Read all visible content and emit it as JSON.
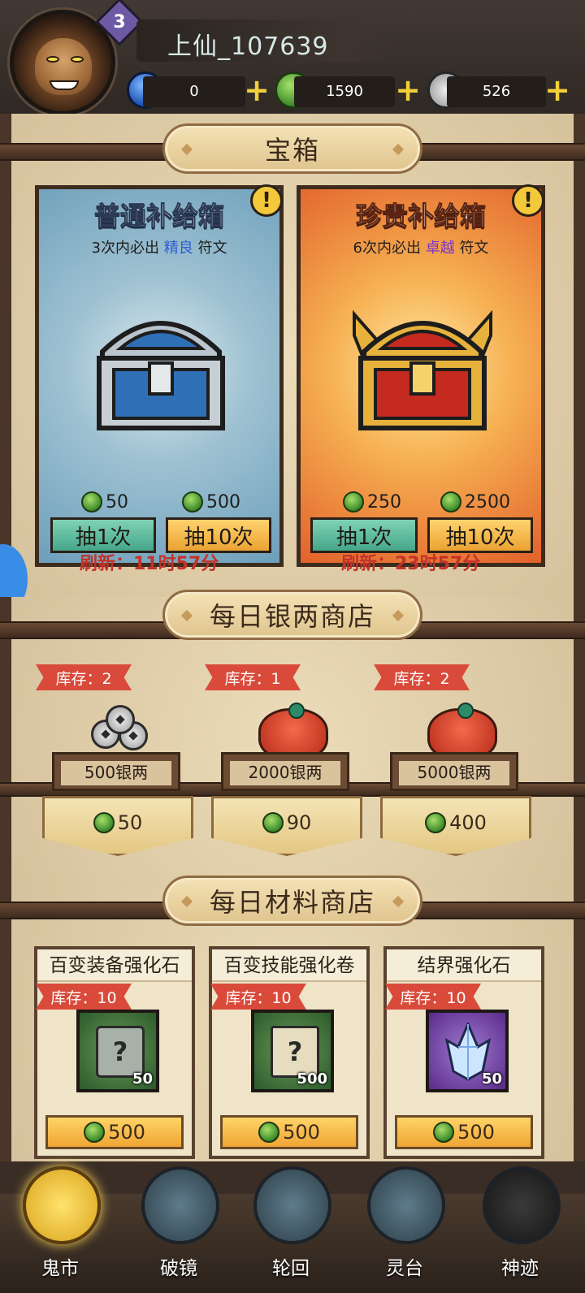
{
  "player": {
    "level": "3",
    "name": "上仙_107639"
  },
  "currencies": [
    {
      "icon": "blue-gem-icon",
      "value": "0"
    },
    {
      "icon": "jade-icon",
      "value": "1590"
    },
    {
      "icon": "silver-coin-icon",
      "value": "526"
    }
  ],
  "chest_section": {
    "title": "宝箱",
    "cards": [
      {
        "title": "普通补给箱",
        "sub_prefix": "3次内必出",
        "sub_highlight": "精良",
        "sub_suffix": "符文",
        "highlight_color": "#2f5fd0",
        "price_once": "50",
        "price_ten": "500",
        "btn_once": "抽1次",
        "btn_ten": "抽10次",
        "refresh": "刷新：11时57分"
      },
      {
        "title": "珍贵补给箱",
        "sub_prefix": "6次内必出",
        "sub_highlight": "卓越",
        "sub_suffix": "符文",
        "highlight_color": "#7a35c8",
        "price_once": "250",
        "price_ten": "2500",
        "btn_once": "抽1次",
        "btn_ten": "抽10次",
        "refresh": "刷新：23时57分"
      }
    ]
  },
  "silver_shop": {
    "title": "每日银两商店",
    "items": [
      {
        "stock": "库存：2",
        "label": "500银两",
        "price": "50"
      },
      {
        "stock": "库存：1",
        "label": "2000银两",
        "price": "90"
      },
      {
        "stock": "库存：2",
        "label": "5000银两",
        "price": "400"
      }
    ]
  },
  "material_shop": {
    "title": "每日材料商店",
    "items": [
      {
        "name": "百变装备强化石",
        "stock": "库存：10",
        "qty": "50",
        "price": "500"
      },
      {
        "name": "百变技能强化卷",
        "stock": "库存：10",
        "qty": "500",
        "price": "500"
      },
      {
        "name": "结界强化石",
        "stock": "库存：10",
        "qty": "50",
        "price": "500"
      }
    ]
  },
  "nav": {
    "items": [
      "鬼市",
      "破镜",
      "轮回",
      "灵台",
      "神迹"
    ],
    "active": "鬼市"
  }
}
